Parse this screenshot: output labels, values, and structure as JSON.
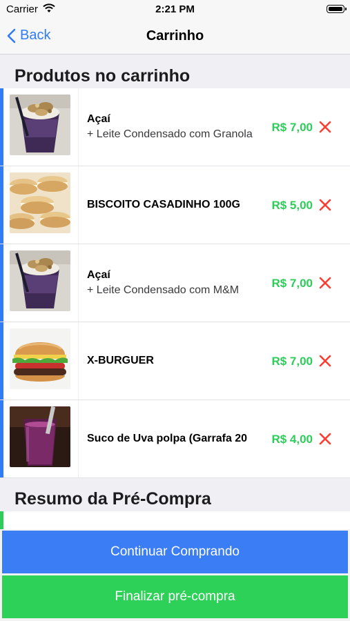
{
  "status_bar": {
    "carrier": "Carrier",
    "time": "2:21 PM",
    "icons": [
      "wifi-icon",
      "battery-icon"
    ]
  },
  "nav": {
    "back_label": "Back",
    "title": "Carrinho"
  },
  "cart": {
    "header": "Produtos no carrinho",
    "items": [
      {
        "name": "Açaí",
        "detail": "+ Leite Condensado com Granola",
        "price": "R$ 7,00",
        "image": "acai-cup"
      },
      {
        "name": "BISCOITO CASADINHO 100G",
        "detail": "",
        "price": "R$ 5,00",
        "image": "biscuits"
      },
      {
        "name": "Açaí",
        "detail": "+ Leite Condensado com M&M",
        "price": "R$ 7,00",
        "image": "acai-cup"
      },
      {
        "name": "X-BURGUER",
        "detail": "",
        "price": "R$ 7,00",
        "image": "burger"
      },
      {
        "name": "Suco de Uva polpa (Garrafa 20",
        "detail": "",
        "price": "R$ 4,00",
        "image": "grape-juice"
      }
    ]
  },
  "summary": {
    "header": "Resumo da Pré-Compra"
  },
  "actions": {
    "continue_label": "Continuar Comprando",
    "finish_label": "Finalizar pré-compra"
  },
  "colors": {
    "accent_blue": "#2f7cf6",
    "price_green": "#2ecc5a",
    "remove_red": "#ff3b30",
    "continue_button": "#3b7df5",
    "finish_button": "#2ed158"
  }
}
